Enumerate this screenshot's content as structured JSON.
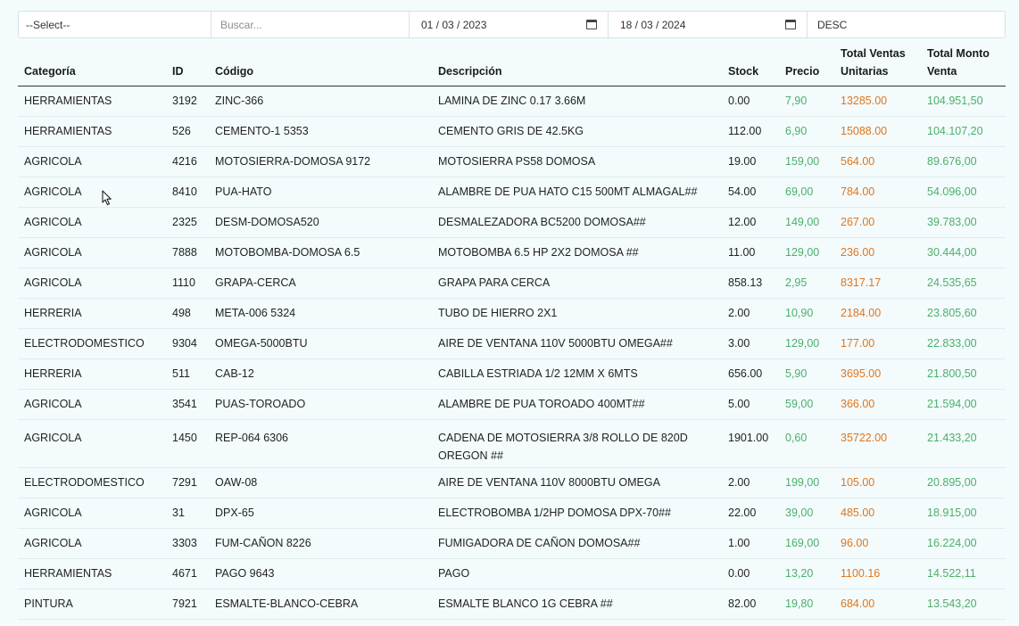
{
  "filters": {
    "category_select": "--Select--",
    "search_placeholder": "Buscar...",
    "date_from": "01 / 03 / 2023",
    "date_to": "18 / 03 / 2024",
    "order": "DESC"
  },
  "table": {
    "headers": {
      "categoria": "Categoría",
      "id": "ID",
      "codigo": "Código",
      "descripcion": "Descripción",
      "stock": "Stock",
      "precio": "Precio",
      "total_ventas_unitarias": "Total Ventas Unitarias",
      "total_monto_venta": "Total Monto Venta"
    },
    "rows": [
      {
        "categoria": "HERRAMIENTAS",
        "id": "3192",
        "codigo": "ZINC-366",
        "descripcion": "LAMINA DE ZINC 0.17 3.66M",
        "stock": "0.00",
        "precio": "7,90",
        "unitarias": "13285.00",
        "monto": "104.951,50"
      },
      {
        "categoria": "HERRAMIENTAS",
        "id": "526",
        "codigo": "CEMENTO-1 5353",
        "descripcion": "CEMENTO GRIS DE 42.5KG",
        "stock": "112.00",
        "precio": "6,90",
        "unitarias": "15088.00",
        "monto": "104.107,20"
      },
      {
        "categoria": "AGRICOLA",
        "id": "4216",
        "codigo": "MOTOSIERRA-DOMOSA 9172",
        "descripcion": "MOTOSIERRA PS58 DOMOSA",
        "stock": "19.00",
        "precio": "159,00",
        "unitarias": "564.00",
        "monto": "89.676,00"
      },
      {
        "categoria": "AGRICOLA",
        "id": "8410",
        "codigo": "PUA-HATO",
        "descripcion": "ALAMBRE DE PUA HATO C15 500MT ALMAGAL##",
        "stock": "54.00",
        "precio": "69,00",
        "unitarias": "784.00",
        "monto": "54.096,00"
      },
      {
        "categoria": "AGRICOLA",
        "id": "2325",
        "codigo": "DESM-DOMOSA520",
        "descripcion": "DESMALEZADORA BC5200 DOMOSA##",
        "stock": "12.00",
        "precio": "149,00",
        "unitarias": "267.00",
        "monto": "39.783,00"
      },
      {
        "categoria": "AGRICOLA",
        "id": "7888",
        "codigo": "MOTOBOMBA-DOMOSA 6.5",
        "descripcion": "MOTOBOMBA 6.5 HP 2X2 DOMOSA ##",
        "stock": "11.00",
        "precio": "129,00",
        "unitarias": "236.00",
        "monto": "30.444,00"
      },
      {
        "categoria": "AGRICOLA",
        "id": "1110",
        "codigo": "GRAPA-CERCA",
        "descripcion": "GRAPA PARA CERCA",
        "stock": "858.13",
        "precio": "2,95",
        "unitarias": "8317.17",
        "monto": "24.535,65"
      },
      {
        "categoria": "HERRERIA",
        "id": "498",
        "codigo": "META-006 5324",
        "descripcion": "TUBO DE HIERRO 2X1",
        "stock": "2.00",
        "precio": "10,90",
        "unitarias": "2184.00",
        "monto": "23.805,60"
      },
      {
        "categoria": "ELECTRODOMESTICO",
        "id": "9304",
        "codigo": "OMEGA-5000BTU",
        "descripcion": "AIRE DE VENTANA 110V 5000BTU OMEGA##",
        "stock": "3.00",
        "precio": "129,00",
        "unitarias": "177.00",
        "monto": "22.833,00"
      },
      {
        "categoria": "HERRERIA",
        "id": "511",
        "codigo": "CAB-12",
        "descripcion": "CABILLA ESTRIADA 1/2 12MM X 6MTS",
        "stock": "656.00",
        "precio": "5,90",
        "unitarias": "3695.00",
        "monto": "21.800,50"
      },
      {
        "categoria": "AGRICOLA",
        "id": "3541",
        "codigo": "PUAS-TOROADO",
        "descripcion": "ALAMBRE DE PUA TOROADO 400MT##",
        "stock": "5.00",
        "precio": "59,00",
        "unitarias": "366.00",
        "monto": "21.594,00"
      },
      {
        "categoria": "AGRICOLA",
        "id": "1450",
        "codigo": "REP-064 6306",
        "descripcion": "CADENA DE MOTOSIERRA 3/8 ROLLO DE 820D OREGON ##",
        "stock": "1901.00",
        "precio": "0,60",
        "unitarias": "35722.00",
        "monto": "21.433,20"
      },
      {
        "categoria": "ELECTRODOMESTICO",
        "id": "7291",
        "codigo": "OAW-08",
        "descripcion": "AIRE DE VENTANA 110V 8000BTU OMEGA",
        "stock": "2.00",
        "precio": "199,00",
        "unitarias": "105.00",
        "monto": "20.895,00"
      },
      {
        "categoria": "AGRICOLA",
        "id": "31",
        "codigo": "DPX-65",
        "descripcion": "ELECTROBOMBA 1/2HP DOMOSA DPX-70##",
        "stock": "22.00",
        "precio": "39,00",
        "unitarias": "485.00",
        "monto": "18.915,00"
      },
      {
        "categoria": "AGRICOLA",
        "id": "3303",
        "codigo": "FUM-CAÑON 8226",
        "descripcion": "FUMIGADORA DE CAÑON DOMOSA##",
        "stock": "1.00",
        "precio": "169,00",
        "unitarias": "96.00",
        "monto": "16.224,00"
      },
      {
        "categoria": "HERRAMIENTAS",
        "id": "4671",
        "codigo": "PAGO 9643",
        "descripcion": "PAGO",
        "stock": "0.00",
        "precio": "13,20",
        "unitarias": "1100.16",
        "monto": "14.522,11"
      },
      {
        "categoria": "PINTURA",
        "id": "7921",
        "codigo": "ESMALTE-BLANCO-CEBRA",
        "descripcion": "ESMALTE BLANCO 1G CEBRA ##",
        "stock": "82.00",
        "precio": "19,80",
        "unitarias": "684.00",
        "monto": "13.543,20"
      }
    ]
  },
  "colors": {
    "price": "#4caf6a",
    "units": "#e0761c",
    "amount": "#4caf6a",
    "background": "#f3fbfd"
  },
  "icons": {
    "date_picker": "calendar-icon",
    "pointer": "mouse-cursor-icon"
  }
}
